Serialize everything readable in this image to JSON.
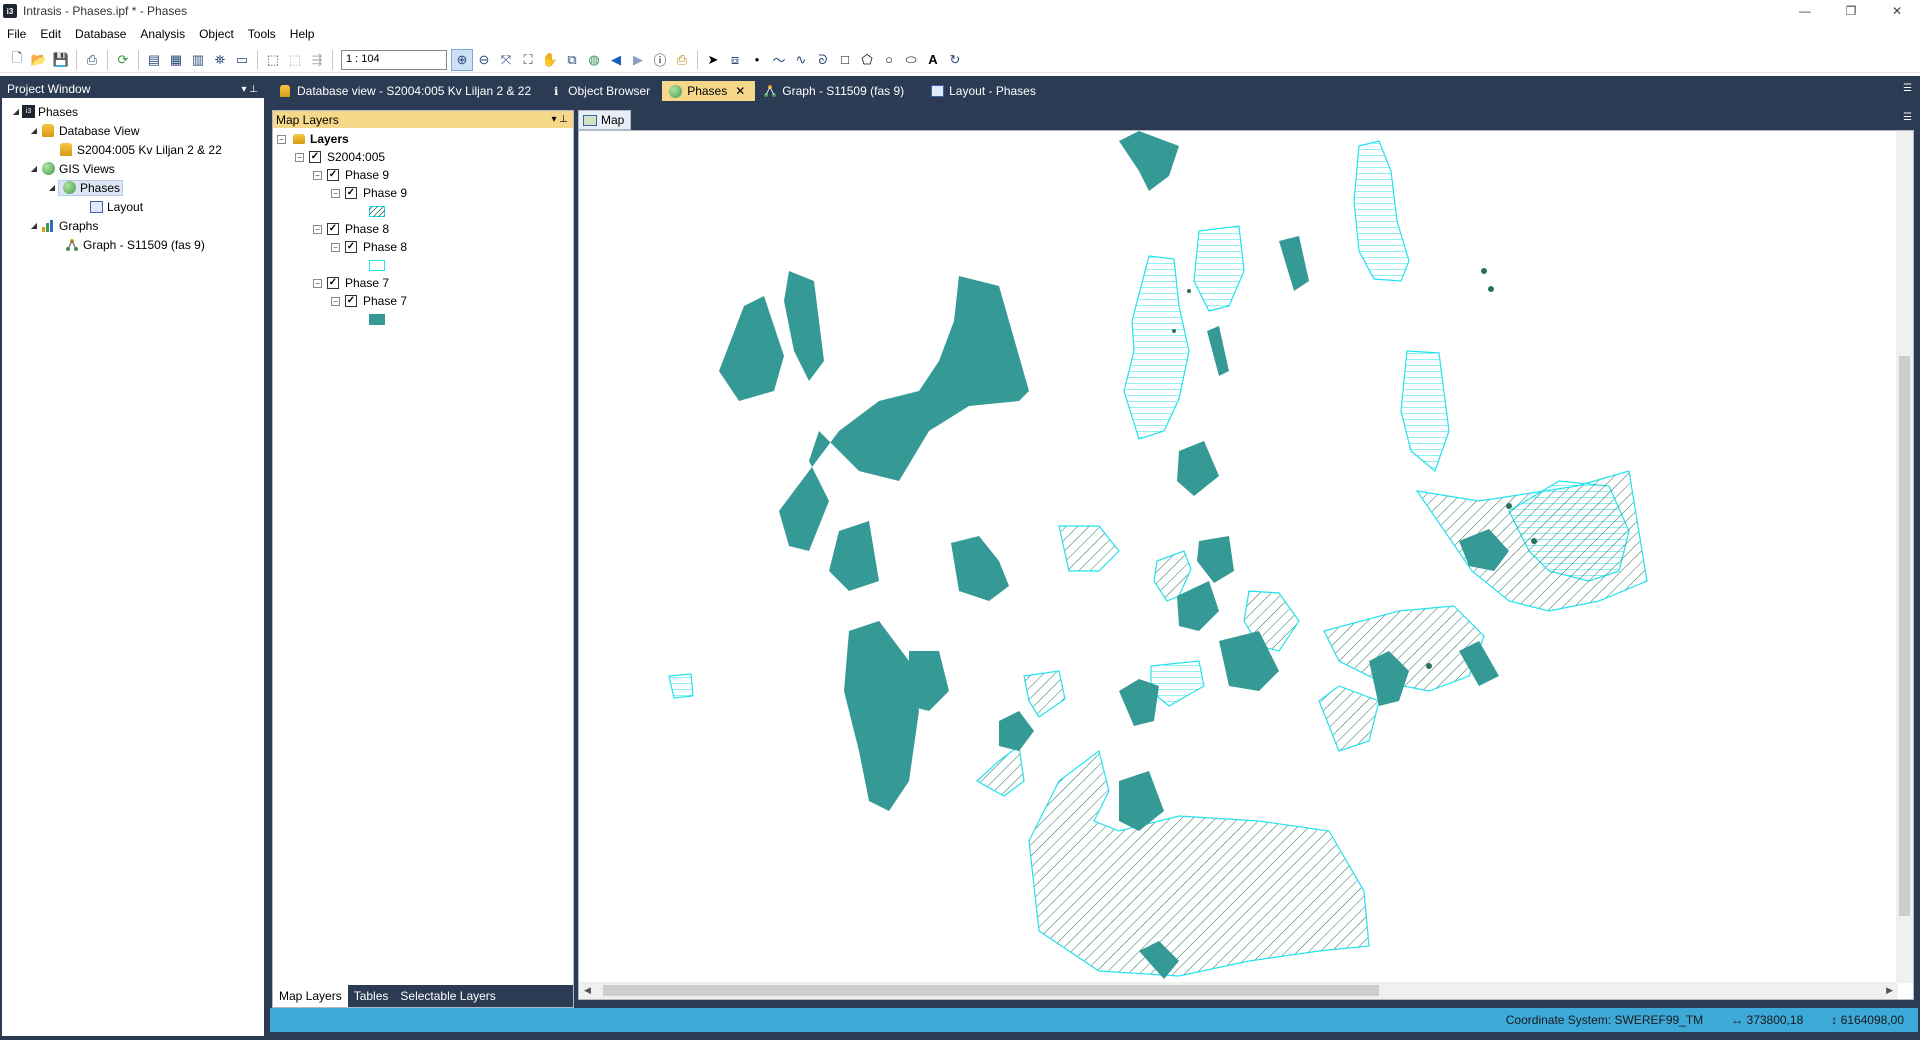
{
  "window": {
    "title": "Intrasis - Phases.ipf * - Phases",
    "app_icon_text": "i3",
    "minimize": "—",
    "restore": "❐",
    "close": "✕"
  },
  "menu": [
    "File",
    "Edit",
    "Database",
    "Analysis",
    "Object",
    "Tools",
    "Help"
  ],
  "toolbar": {
    "scale_value": "1 : 104"
  },
  "project_window": {
    "title": "Project Window",
    "pin": "▾ ⊥",
    "items": [
      {
        "label": "Phases"
      },
      {
        "label": "Database View"
      },
      {
        "label": "S2004:005 Kv Liljan 2 & 22"
      },
      {
        "label": "GIS Views"
      },
      {
        "label": "Phases"
      },
      {
        "label": "Layout"
      },
      {
        "label": "Graphs"
      },
      {
        "label": "Graph - S11509 (fas 9)"
      }
    ]
  },
  "doc_tabs": [
    {
      "label": "Database view - S2004:005 Kv Liljan 2 & 22",
      "active": false
    },
    {
      "label": "Object Browser",
      "active": false
    },
    {
      "label": "Phases",
      "active": true
    },
    {
      "label": "Graph - S11509 (fas 9)",
      "active": false
    },
    {
      "label": "Layout - Phases",
      "active": false
    }
  ],
  "map_layers": {
    "title": "Map Layers",
    "root": "Layers",
    "group": "S2004:005",
    "phases": [
      {
        "group": "Phase 9",
        "layer": "Phase 9",
        "style": "hatch-diagonal"
      },
      {
        "group": "Phase 8",
        "layer": "Phase 8",
        "style": "outline"
      },
      {
        "group": "Phase 7",
        "layer": "Phase 7",
        "style": "filled"
      }
    ],
    "bottom_tabs": [
      "Map Layers",
      "Tables",
      "Selectable Layers"
    ]
  },
  "map": {
    "tab_label": "Map",
    "fill_color": "#359a95",
    "outline_color": "#22e2ee",
    "hatch_color": "#2d6f5e"
  },
  "status": {
    "coordinate_system": "Coordinate System: SWEREF99_TM",
    "x": "373800,18",
    "y": "6164098,00"
  }
}
